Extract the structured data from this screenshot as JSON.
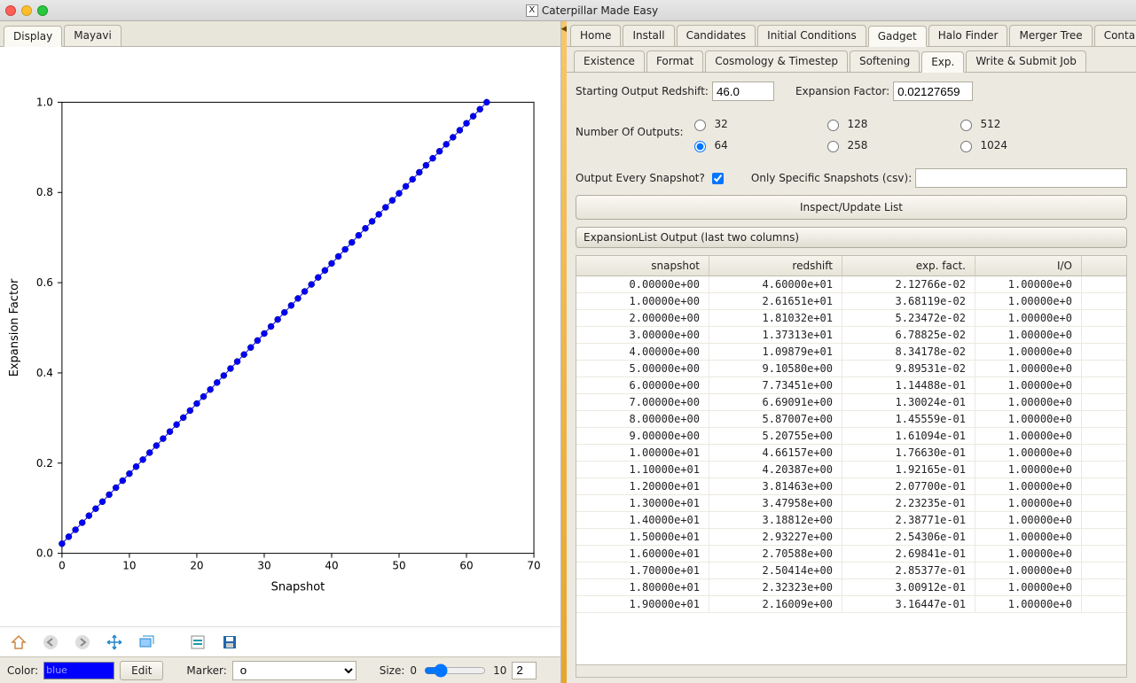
{
  "window": {
    "title": "Caterpillar Made Easy"
  },
  "left_tabs": [
    "Display",
    "Mayavi"
  ],
  "left_active_tab": 0,
  "chart_data": {
    "type": "scatter",
    "xlabel": "Snapshot",
    "ylabel": "Expansion Factor",
    "xlim": [
      0,
      70
    ],
    "ylim": [
      0,
      1.0
    ],
    "xticks": [
      0,
      10,
      20,
      30,
      40,
      50,
      60,
      70
    ],
    "yticks": [
      0.0,
      0.2,
      0.4,
      0.6,
      0.8,
      1.0
    ],
    "series": [
      {
        "name": "expansion",
        "marker": "o",
        "color": "#0000ff",
        "x": [
          0,
          1,
          2,
          3,
          4,
          5,
          6,
          7,
          8,
          9,
          10,
          11,
          12,
          13,
          14,
          15,
          16,
          17,
          18,
          19,
          20,
          21,
          22,
          23,
          24,
          25,
          26,
          27,
          28,
          29,
          30,
          31,
          32,
          33,
          34,
          35,
          36,
          37,
          38,
          39,
          40,
          41,
          42,
          43,
          44,
          45,
          46,
          47,
          48,
          49,
          50,
          51,
          52,
          53,
          54,
          55,
          56,
          57,
          58,
          59,
          60,
          61,
          62,
          63
        ],
        "y": [
          0.0213,
          0.0368,
          0.0523,
          0.0679,
          0.0834,
          0.099,
          0.1145,
          0.13,
          0.1456,
          0.1611,
          0.1766,
          0.1922,
          0.2077,
          0.2232,
          0.2388,
          0.2543,
          0.2698,
          0.2854,
          0.3009,
          0.3164,
          0.332,
          0.3475,
          0.3631,
          0.3786,
          0.3941,
          0.4097,
          0.4252,
          0.4407,
          0.4563,
          0.4718,
          0.4873,
          0.5029,
          0.5184,
          0.534,
          0.5495,
          0.565,
          0.5806,
          0.5961,
          0.6116,
          0.6272,
          0.6427,
          0.6582,
          0.6738,
          0.6893,
          0.7049,
          0.7204,
          0.7359,
          0.7515,
          0.767,
          0.7825,
          0.7981,
          0.8136,
          0.8291,
          0.8447,
          0.8602,
          0.8758,
          0.8913,
          0.9068,
          0.9224,
          0.9379,
          0.9534,
          0.969,
          0.9845,
          1.0
        ]
      }
    ]
  },
  "plot_toolbar": {
    "color_label": "Color:",
    "color_value": "blue",
    "edit_label": "Edit",
    "marker_label": "Marker:",
    "marker_value": "o",
    "size_label": "Size:",
    "size_min": "0",
    "size_max": "10",
    "size_value": "2"
  },
  "right_tabs": [
    "Home",
    "Install",
    "Candidates",
    "Initial Conditions",
    "Gadget",
    "Halo Finder",
    "Merger Tree",
    "Contam."
  ],
  "right_active_tab": 4,
  "sub_tabs": [
    "Existence",
    "Format",
    "Cosmology & Timestep",
    "Softening",
    "Exp.",
    "Write & Submit Job"
  ],
  "sub_active_tab": 4,
  "form": {
    "starting_redshift_label": "Starting Output Redshift:",
    "starting_redshift_value": "46.0",
    "expansion_factor_label": "Expansion Factor:",
    "expansion_factor_value": "0.02127659",
    "num_outputs_label": "Number Of Outputs:",
    "num_outputs_options": [
      "32",
      "64",
      "128",
      "258",
      "512",
      "1024"
    ],
    "num_outputs_selected": "64",
    "every_snapshot_label": "Output Every Snapshot?",
    "every_snapshot_checked": true,
    "only_specific_label": "Only Specific Snapshots (csv):",
    "only_specific_value": "",
    "inspect_button": "Inspect/Update List",
    "group_header": "ExpansionList Output (last two columns)"
  },
  "table": {
    "headers": [
      "snapshot",
      "redshift",
      "exp. fact.",
      "I/O"
    ],
    "rows": [
      [
        "0.00000e+00",
        "4.60000e+01",
        "2.12766e-02",
        "1.00000e+0"
      ],
      [
        "1.00000e+00",
        "2.61651e+01",
        "3.68119e-02",
        "1.00000e+0"
      ],
      [
        "2.00000e+00",
        "1.81032e+01",
        "5.23472e-02",
        "1.00000e+0"
      ],
      [
        "3.00000e+00",
        "1.37313e+01",
        "6.78825e-02",
        "1.00000e+0"
      ],
      [
        "4.00000e+00",
        "1.09879e+01",
        "8.34178e-02",
        "1.00000e+0"
      ],
      [
        "5.00000e+00",
        "9.10580e+00",
        "9.89531e-02",
        "1.00000e+0"
      ],
      [
        "6.00000e+00",
        "7.73451e+00",
        "1.14488e-01",
        "1.00000e+0"
      ],
      [
        "7.00000e+00",
        "6.69091e+00",
        "1.30024e-01",
        "1.00000e+0"
      ],
      [
        "8.00000e+00",
        "5.87007e+00",
        "1.45559e-01",
        "1.00000e+0"
      ],
      [
        "9.00000e+00",
        "5.20755e+00",
        "1.61094e-01",
        "1.00000e+0"
      ],
      [
        "1.00000e+01",
        "4.66157e+00",
        "1.76630e-01",
        "1.00000e+0"
      ],
      [
        "1.10000e+01",
        "4.20387e+00",
        "1.92165e-01",
        "1.00000e+0"
      ],
      [
        "1.20000e+01",
        "3.81463e+00",
        "2.07700e-01",
        "1.00000e+0"
      ],
      [
        "1.30000e+01",
        "3.47958e+00",
        "2.23235e-01",
        "1.00000e+0"
      ],
      [
        "1.40000e+01",
        "3.18812e+00",
        "2.38771e-01",
        "1.00000e+0"
      ],
      [
        "1.50000e+01",
        "2.93227e+00",
        "2.54306e-01",
        "1.00000e+0"
      ],
      [
        "1.60000e+01",
        "2.70588e+00",
        "2.69841e-01",
        "1.00000e+0"
      ],
      [
        "1.70000e+01",
        "2.50414e+00",
        "2.85377e-01",
        "1.00000e+0"
      ],
      [
        "1.80000e+01",
        "2.32323e+00",
        "3.00912e-01",
        "1.00000e+0"
      ],
      [
        "1.90000e+01",
        "2.16009e+00",
        "3.16447e-01",
        "1.00000e+0"
      ]
    ]
  }
}
